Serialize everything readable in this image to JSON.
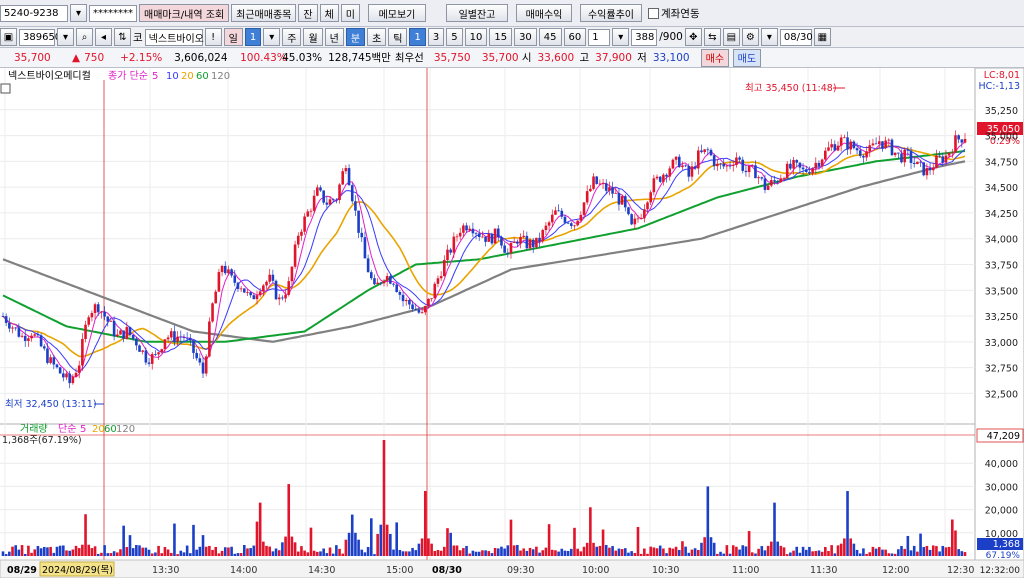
{
  "toolbar1": {
    "account": "5240-9238",
    "password": "********",
    "buttons": [
      "매매마크/내역 조회",
      "최근매매종목",
      "잔",
      "체",
      "미",
      "메모보기",
      "일별잔고",
      "매매수익",
      "수익률추이"
    ],
    "link_label": "계좌연동"
  },
  "toolbar2": {
    "code": "389650",
    "stock_name": "넥스트바이오",
    "market_tag": "코",
    "periods": [
      "일",
      "1",
      "주",
      "월",
      "년",
      "분",
      "초",
      "틱"
    ],
    "minute_options": [
      "1",
      "3",
      "5",
      "10",
      "15",
      "30",
      "45",
      "60"
    ],
    "unit": "1",
    "count": "388",
    "count_total": "/900",
    "date": "08/30"
  },
  "quote": {
    "price": "35,700",
    "change": "750",
    "change_pct": "+2.15%",
    "volume": "3,606,024",
    "prev_vol_ratio": "100.43%",
    "turnover_ratio": "45.03%",
    "amount": "128,745백만",
    "best_label": "최우선",
    "best_ask": "35,750",
    "best_bid": "35,700",
    "open_label": "시",
    "open": "33,600",
    "high_label": "고",
    "high": "37,900",
    "low_label": "저",
    "low": "33,100",
    "buy_label": "매수",
    "sell_label": "매도"
  },
  "price_pane": {
    "legend_name": "넥스트바이오메디컬",
    "legend_ma": "종가 단순",
    "ma_periods": [
      "5",
      "10",
      "20",
      "60",
      "120"
    ],
    "ma_colors": [
      "#e020c8",
      "#3a3aff",
      "#e8a400",
      "#10a030",
      "#808080"
    ],
    "high_note": "최고 35,450 (11:48)",
    "low_note": "최저 32,450 (13:11)",
    "lc": "LC:8,01",
    "hc": "HC:-1,13",
    "current_badge": "35,050",
    "current_pct": "0.29%",
    "y_ticks": [
      "35,250",
      "35,000",
      "34,750",
      "34,500",
      "34,250",
      "34,000",
      "33,750",
      "33,500",
      "33,250",
      "33,000",
      "32,750",
      "32,500"
    ]
  },
  "volume_pane": {
    "legend_name": "거래량",
    "legend_ma": "단순",
    "ma_periods": [
      "5",
      "20",
      "60",
      "120"
    ],
    "current_text": "1,368주(67.19%)",
    "threshold_badge": "47,209",
    "current_badge": "1,368",
    "current_pct": "67.19%",
    "y_ticks": [
      "40,000",
      "30,000",
      "20,000",
      "10,000"
    ]
  },
  "time_axis": {
    "labels": [
      "08/29",
      "2024/08/29(목)",
      "13:30",
      "14:00",
      "14:30",
      "15:00",
      "08/30",
      "09:30",
      "10:00",
      "10:30",
      "11:00",
      "11:30",
      "12:00",
      "12:30"
    ],
    "right_label": "12:32:00"
  },
  "chart_data": {
    "type": "candlestick",
    "x_range": [
      "2024/08/29 13:00",
      "2024/08/30 12:32"
    ],
    "ylim_price": [
      32300,
      35500
    ],
    "ylim_volume": [
      0,
      50000
    ],
    "price_path": [
      [
        0,
        33250
      ],
      [
        3,
        33150
      ],
      [
        6,
        33050
      ],
      [
        9,
        33100
      ],
      [
        12,
        32950
      ],
      [
        15,
        32800
      ],
      [
        18,
        32700
      ],
      [
        21,
        32600
      ],
      [
        24,
        32800
      ],
      [
        27,
        33300
      ],
      [
        30,
        33350
      ],
      [
        33,
        33200
      ],
      [
        36,
        33050
      ],
      [
        39,
        33100
      ],
      [
        42,
        33000
      ],
      [
        45,
        32850
      ],
      [
        48,
        32850
      ],
      [
        51,
        33050
      ],
      [
        54,
        33050
      ],
      [
        57,
        33050
      ],
      [
        60,
        32900
      ],
      [
        63,
        32700
      ],
      [
        66,
        33350
      ],
      [
        69,
        33750
      ],
      [
        72,
        33600
      ],
      [
        75,
        33550
      ],
      [
        78,
        33400
      ],
      [
        81,
        33550
      ],
      [
        84,
        33600
      ],
      [
        87,
        33400
      ],
      [
        90,
        33550
      ],
      [
        93,
        34050
      ],
      [
        96,
        34250
      ],
      [
        99,
        34450
      ],
      [
        102,
        34350
      ],
      [
        105,
        34400
      ],
      [
        108,
        34750
      ],
      [
        111,
        34250
      ],
      [
        114,
        33800
      ],
      [
        117,
        33500
      ],
      [
        120,
        33650
      ],
      [
        123,
        33600
      ],
      [
        126,
        33400
      ],
      [
        129,
        33350
      ],
      [
        132,
        33250
      ],
      [
        135,
        33450
      ],
      [
        138,
        33700
      ],
      [
        141,
        33900
      ],
      [
        144,
        34100
      ],
      [
        147,
        34150
      ],
      [
        150,
        34050
      ],
      [
        153,
        34000
      ],
      [
        156,
        34050
      ],
      [
        159,
        33850
      ],
      [
        162,
        34000
      ],
      [
        165,
        33950
      ],
      [
        168,
        33950
      ],
      [
        171,
        34100
      ],
      [
        174,
        34250
      ],
      [
        177,
        34200
      ],
      [
        180,
        34150
      ],
      [
        183,
        34350
      ],
      [
        186,
        34550
      ],
      [
        189,
        34500
      ],
      [
        192,
        34450
      ],
      [
        195,
        34350
      ],
      [
        198,
        34100
      ],
      [
        201,
        34250
      ],
      [
        204,
        34500
      ],
      [
        207,
        34600
      ],
      [
        210,
        34700
      ],
      [
        213,
        34750
      ],
      [
        216,
        34600
      ],
      [
        219,
        34800
      ],
      [
        222,
        34850
      ],
      [
        225,
        34700
      ],
      [
        228,
        34700
      ],
      [
        231,
        34800
      ],
      [
        234,
        34650
      ],
      [
        237,
        34650
      ],
      [
        240,
        34500
      ],
      [
        243,
        34550
      ],
      [
        246,
        34650
      ],
      [
        249,
        34700
      ],
      [
        252,
        34650
      ],
      [
        255,
        34700
      ],
      [
        258,
        34800
      ],
      [
        261,
        34900
      ],
      [
        264,
        34950
      ],
      [
        267,
        34900
      ],
      [
        270,
        34850
      ],
      [
        273,
        34850
      ],
      [
        276,
        34950
      ],
      [
        279,
        34900
      ],
      [
        282,
        34800
      ],
      [
        285,
        34800
      ],
      [
        288,
        34700
      ],
      [
        291,
        34650
      ],
      [
        294,
        34750
      ],
      [
        297,
        34800
      ],
      [
        300,
        34950
      ],
      [
        303,
        35000
      ]
    ],
    "ma120_path": [
      [
        0,
        33800
      ],
      [
        30,
        33450
      ],
      [
        60,
        33100
      ],
      [
        85,
        33000
      ],
      [
        110,
        33150
      ],
      [
        135,
        33350
      ],
      [
        160,
        33700
      ],
      [
        190,
        33850
      ],
      [
        220,
        34000
      ],
      [
        245,
        34250
      ],
      [
        270,
        34500
      ],
      [
        295,
        34700
      ],
      [
        303,
        34750
      ]
    ],
    "ma60_path": [
      [
        0,
        33450
      ],
      [
        20,
        33150
      ],
      [
        45,
        33000
      ],
      [
        70,
        33000
      ],
      [
        95,
        33100
      ],
      [
        115,
        33500
      ],
      [
        130,
        33750
      ],
      [
        150,
        33800
      ],
      [
        175,
        33950
      ],
      [
        200,
        34100
      ],
      [
        225,
        34400
      ],
      [
        250,
        34600
      ],
      [
        275,
        34750
      ],
      [
        303,
        34850
      ]
    ],
    "volume_peaks": [
      [
        26,
        18000
      ],
      [
        63,
        9000
      ],
      [
        81,
        23000
      ],
      [
        90,
        31000
      ],
      [
        110,
        37000
      ],
      [
        120,
        50000
      ],
      [
        133,
        28000
      ],
      [
        140,
        12000
      ],
      [
        160,
        17000
      ],
      [
        185,
        21000
      ],
      [
        222,
        30000
      ],
      [
        243,
        23000
      ],
      [
        266,
        28000
      ],
      [
        300,
        11000
      ]
    ]
  }
}
